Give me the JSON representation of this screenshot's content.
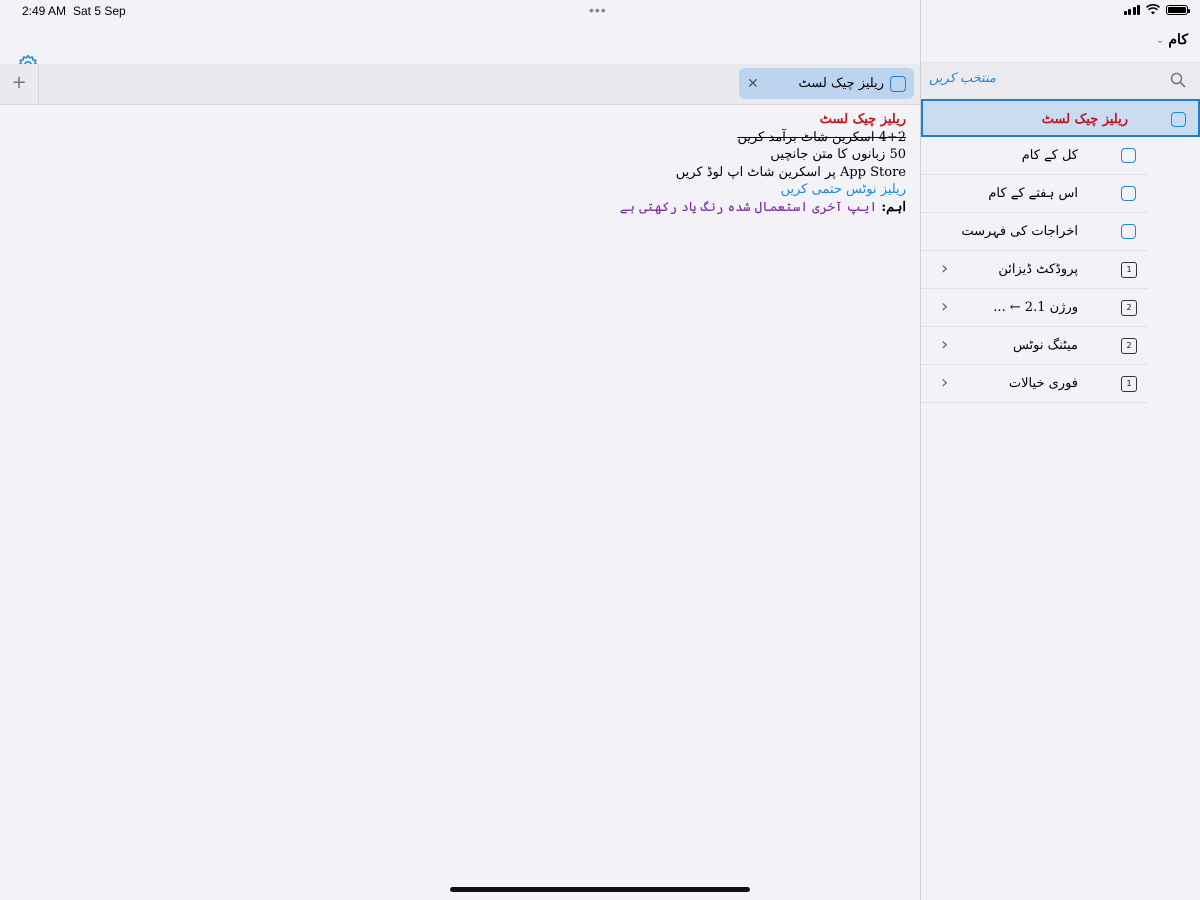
{
  "status": {
    "time": "2:49 AM",
    "date": "Sat 5 Sep",
    "multitask": "•••"
  },
  "tabs": [
    {
      "title": "ریلیز چیک لسٹ",
      "close": "✕"
    }
  ],
  "new_tab": "+",
  "note": {
    "title": "ریلیز چیک لسٹ",
    "lines": [
      "4+2 اسکرین شاٹ برآمد کریں",
      "50 زبانوں کا متن جانچیں",
      "App Store پر اسکرین شاٹ اپ لوڈ کریں",
      "ریلیز نوٹس حتمی کریں"
    ],
    "important_label": "اہم:",
    "important_text": "ایپ آخری استعمال شدہ رنگ یاد رکھتی ہے"
  },
  "sidebar": {
    "header": "کام",
    "select_button": "منتخب کریں",
    "items": [
      {
        "label": "ریلیز چیک لسٹ",
        "kind": "note"
      },
      {
        "label": "کل کے کام",
        "kind": "note"
      },
      {
        "label": "اس ہفتے کے کام",
        "kind": "note"
      },
      {
        "label": "اخراجات کی فہرست",
        "kind": "note"
      },
      {
        "label": "پروڈکٹ ڈیزائن",
        "kind": "folder",
        "count": "1"
      },
      {
        "label": "ورژن 2.1 ← ...",
        "kind": "folder",
        "count": "2"
      },
      {
        "label": "میٹنگ نوٹس",
        "kind": "folder",
        "count": "2"
      },
      {
        "label": "فوری خیالات",
        "kind": "folder",
        "count": "1"
      }
    ]
  },
  "colors": {
    "accent": "#1c8ad6",
    "title_red": "#c0141c",
    "purple": "#7c2b9c",
    "selected_bg": "#c9dcf2"
  }
}
